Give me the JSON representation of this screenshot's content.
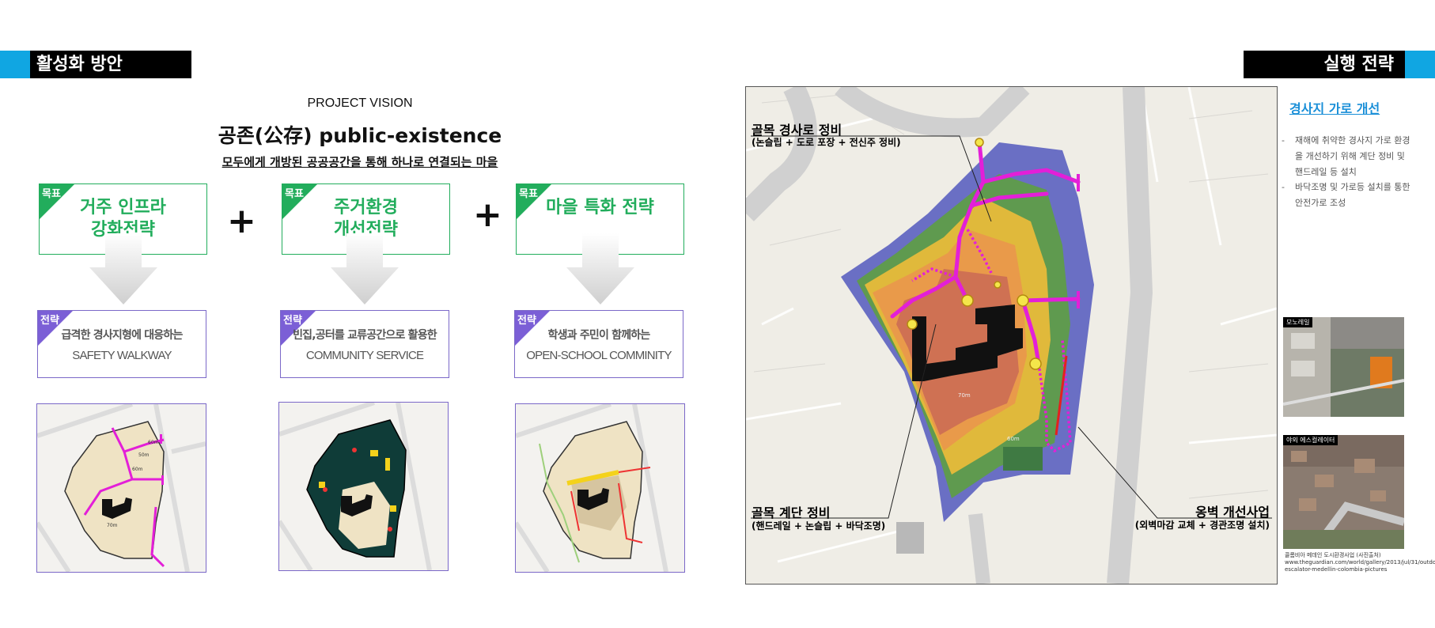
{
  "header_left": {
    "title": "활성화 방안"
  },
  "header_right": {
    "title": "실행 전략"
  },
  "vision": {
    "label": "PROJECT VISION",
    "title": "공존(公存) public-existence",
    "subtitle": "모두에게 개방된 공공공간을 통해 하나로 연결되는 마을"
  },
  "goals": [
    {
      "tag": "목표",
      "line1": "거주 인프라",
      "line2": "강화전략"
    },
    {
      "tag": "목표",
      "line1": "주거환경",
      "line2": "개선전략"
    },
    {
      "tag": "목표",
      "line1": "마을 특화 전략",
      "line2": ""
    }
  ],
  "plus": "+",
  "strategies": [
    {
      "tag": "전략",
      "line1": "급격한 경사지형에 대응하는",
      "line2": "SAFETY WALKWAY"
    },
    {
      "tag": "전략",
      "line1": "빈집,공터를 교류공간으로 활용한",
      "line2": "COMMUNITY SERVICE"
    },
    {
      "tag": "전략",
      "line1": "학생과 주민이 함께하는",
      "line2": "OPEN-SCHOOL COMMINITY"
    }
  ],
  "mini_map_labels": {
    "a": "60m",
    "b": "50m",
    "c": "60m",
    "d": "70m"
  },
  "big_map": {
    "label1_title": "골목 경사로 정비",
    "label1_sub": "(논슬립 + 도로 포장 + 전신주 정비)",
    "label2_title": "골목 계단 정비",
    "label2_sub": "(핸드레일 + 논슬립 + 바닥조명)",
    "label3_title": "옹벽 개선사업",
    "label3_sub": "(외벽마감 교체 + 경관조명 설치)",
    "contour_a": "70m",
    "contour_b": "60m"
  },
  "side": {
    "title": "경사지 가로 개선",
    "items": [
      "재해에 취약한 경사지 가로 환경을 개선하기 위해 계단 정비 및 핸드레일 등 설치",
      "바닥조명 및 가로등 설치를 통한 안전가로 조성"
    ],
    "bullet": "-"
  },
  "photos": [
    {
      "title": "모노레일"
    },
    {
      "title": "야외 에스컬레이터"
    }
  ],
  "caption": "콜롬비아 메데인 도시환경사업 (사진출처) www.theguardian.com/world/gallery/2013/jul/31/outdoor-escalator-medellin-colombia-pictures",
  "colors": {
    "green": "#22ad5c",
    "purple": "#7b5fd6",
    "cyan": "#10a6e2",
    "magenta": "#e31fd8"
  }
}
